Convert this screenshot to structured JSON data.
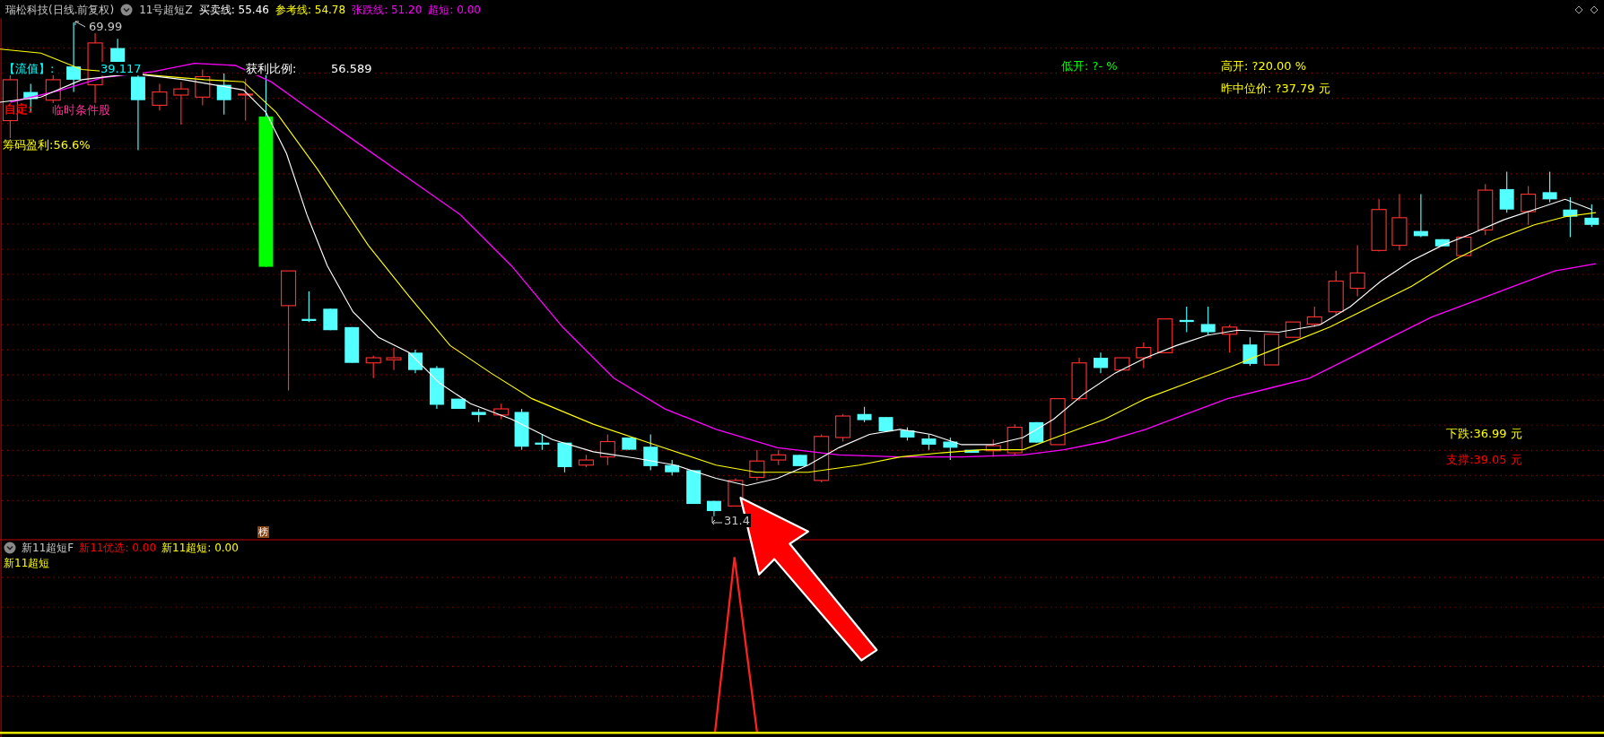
{
  "header": {
    "title": "瑞松科技(日线.前复权)",
    "indicator": "11号超短Z",
    "readings": [
      {
        "label": "买卖线:",
        "value": "55.46",
        "color": "#ffffff"
      },
      {
        "label": "参考线:",
        "value": "54.78",
        "color": "#ffff00"
      },
      {
        "label": "张跌线:",
        "value": "51.20",
        "color": "#ff00ff"
      },
      {
        "label": "超短:",
        "value": "0.00",
        "color": "#ff00ff"
      }
    ]
  },
  "main_chart": {
    "high_marker": "69.99",
    "low_marker": "31.4",
    "badge": "榜",
    "labels": [
      {
        "text": "【流值】:",
        "color": "#00ffff"
      },
      {
        "text": "39.117",
        "color": "#00ffff"
      },
      {
        "text": "自定:",
        "color": "#ff0000"
      },
      {
        "text": "临时条件股",
        "color": "#ff3399"
      },
      {
        "text": "筹码盈利:56.6%",
        "color": "#ffff00"
      },
      {
        "text": "获利比例:",
        "color": "#ffffff"
      },
      {
        "text": "56.589",
        "color": "#ffffff"
      },
      {
        "text": "低开: ?- %",
        "color": "#00ff00"
      },
      {
        "text": "高开: ?20.00 %",
        "color": "#ffff00"
      },
      {
        "text": "昨中位价: ?37.79 元",
        "color": "#ffff00"
      },
      {
        "text": "下跌:36.99 元",
        "color": "#ffff00"
      },
      {
        "text": "支撑:39.05 元",
        "color": "#ff0000"
      }
    ]
  },
  "lower_panel": {
    "indicator": "新11超短F",
    "readings": [
      {
        "label": "新11优选:",
        "value": "0.00",
        "color": "#ff0000"
      },
      {
        "label": "新11超短:",
        "value": "0.00",
        "color": "#ffff00"
      }
    ],
    "legend": "新11超短"
  }
}
